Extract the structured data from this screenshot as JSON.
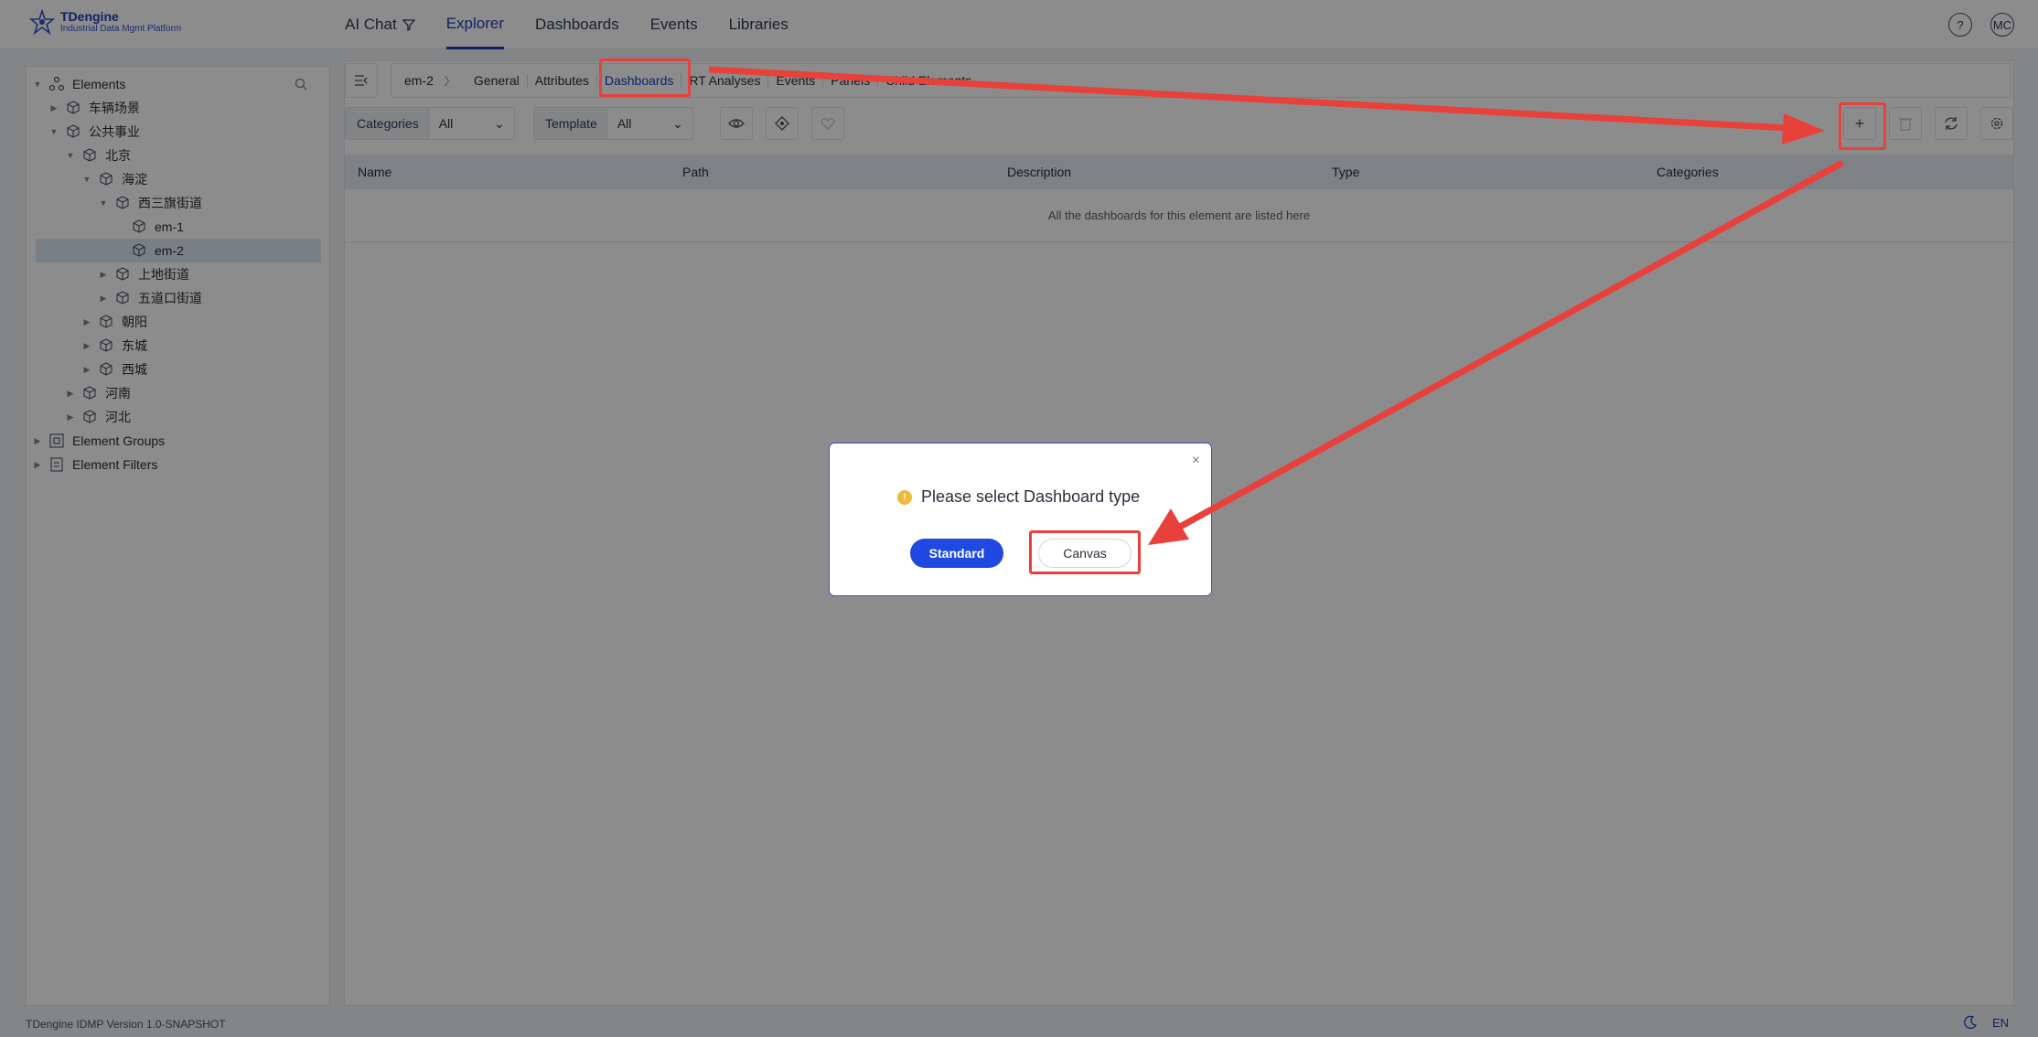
{
  "app": {
    "logo_title": "TDengine",
    "logo_subtitle": "Industrial Data Mgmt Platform",
    "version": "TDengine IDMP Version 1.0-SNAPSHOT",
    "language": "EN",
    "help_label": "?",
    "user_initials": "MC"
  },
  "nav": {
    "items": [
      {
        "label": "AI Chat",
        "active": false,
        "icon": "ai-filter-icon"
      },
      {
        "label": "Explorer",
        "active": true
      },
      {
        "label": "Dashboards",
        "active": false
      },
      {
        "label": "Events",
        "active": false
      },
      {
        "label": "Libraries",
        "active": false
      }
    ]
  },
  "tree": {
    "root_label": "Elements",
    "nodes": [
      {
        "label": "车辆场景",
        "expanded": false
      },
      {
        "label": "公共事业",
        "expanded": true
      },
      {
        "label": "北京",
        "expanded": true
      },
      {
        "label": "海淀",
        "expanded": true
      },
      {
        "label": "西三旗街道",
        "expanded": true
      },
      {
        "label": "em-1",
        "leaf": true
      },
      {
        "label": "em-2",
        "leaf": true,
        "selected": true
      },
      {
        "label": "上地街道",
        "expanded": false
      },
      {
        "label": "五道口街道",
        "expanded": false
      },
      {
        "label": "朝阳",
        "expanded": false
      },
      {
        "label": "东城",
        "expanded": false
      },
      {
        "label": "西城",
        "expanded": false
      },
      {
        "label": "河南",
        "expanded": false
      },
      {
        "label": "河北",
        "expanded": false
      }
    ],
    "groups_label": "Element Groups",
    "filters_label": "Element Filters"
  },
  "breadcrumb": {
    "element": "em-2",
    "tabs": [
      "General",
      "Attributes",
      "Dashboards",
      "RT Analyses",
      "Events",
      "Panels",
      "Child Elements"
    ],
    "active_tab": "Dashboards"
  },
  "toolbar": {
    "categories_label": "Categories",
    "categories_value": "All",
    "template_label": "Template",
    "template_value": "All"
  },
  "table": {
    "columns": [
      "Name",
      "Path",
      "Description",
      "Type",
      "Categories"
    ],
    "empty_text": "All the dashboards for this element are listed here"
  },
  "modal": {
    "message": "Please select Dashboard type",
    "standard_label": "Standard",
    "canvas_label": "Canvas",
    "close_label": "×"
  },
  "colors": {
    "accent": "#1d3fb8",
    "primary_button": "#1f49e0",
    "highlight": "#e8403a",
    "warning": "#f0b93a"
  }
}
